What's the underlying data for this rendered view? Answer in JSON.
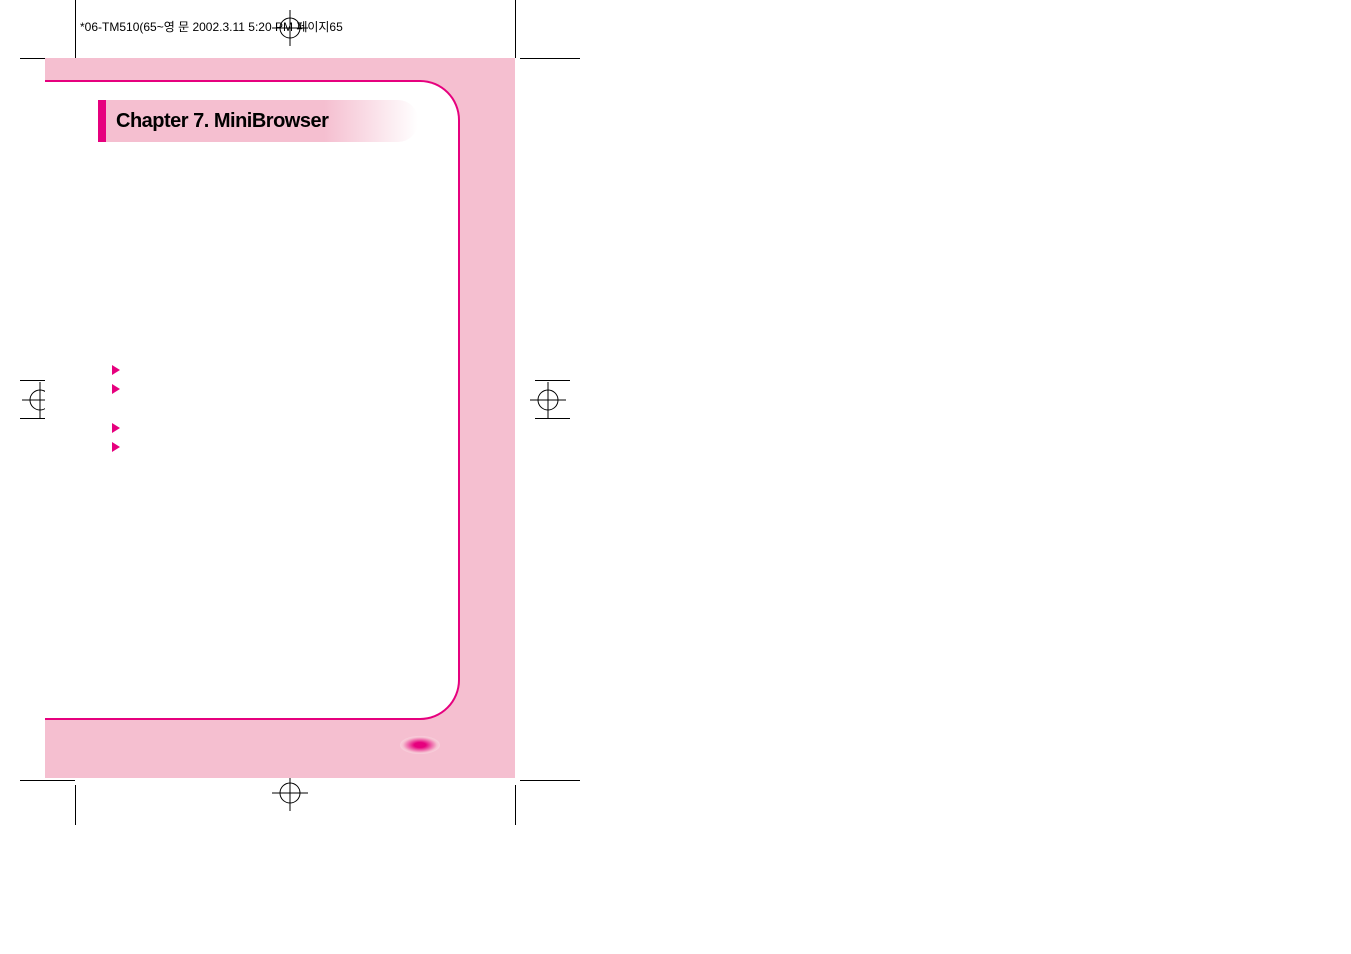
{
  "header": {
    "text": "*06-TM510(65~영 문  2002.3.11 5:20 PM 페이지65"
  },
  "chapter": {
    "title": "Chapter 7. MiniBrowser"
  }
}
